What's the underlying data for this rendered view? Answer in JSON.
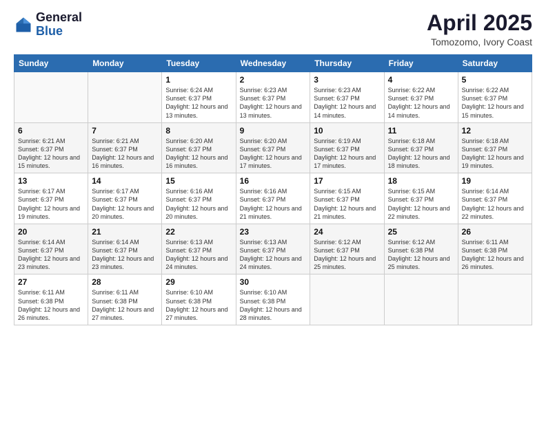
{
  "header": {
    "logo_general": "General",
    "logo_blue": "Blue",
    "month_title": "April 2025",
    "location": "Tomozomo, Ivory Coast"
  },
  "days_of_week": [
    "Sunday",
    "Monday",
    "Tuesday",
    "Wednesday",
    "Thursday",
    "Friday",
    "Saturday"
  ],
  "weeks": [
    [
      {
        "day": "",
        "sunrise": "",
        "sunset": "",
        "daylight": "",
        "empty": true
      },
      {
        "day": "",
        "sunrise": "",
        "sunset": "",
        "daylight": "",
        "empty": true
      },
      {
        "day": "1",
        "sunrise": "Sunrise: 6:24 AM",
        "sunset": "Sunset: 6:37 PM",
        "daylight": "Daylight: 12 hours and 13 minutes."
      },
      {
        "day": "2",
        "sunrise": "Sunrise: 6:23 AM",
        "sunset": "Sunset: 6:37 PM",
        "daylight": "Daylight: 12 hours and 13 minutes."
      },
      {
        "day": "3",
        "sunrise": "Sunrise: 6:23 AM",
        "sunset": "Sunset: 6:37 PM",
        "daylight": "Daylight: 12 hours and 14 minutes."
      },
      {
        "day": "4",
        "sunrise": "Sunrise: 6:22 AM",
        "sunset": "Sunset: 6:37 PM",
        "daylight": "Daylight: 12 hours and 14 minutes."
      },
      {
        "day": "5",
        "sunrise": "Sunrise: 6:22 AM",
        "sunset": "Sunset: 6:37 PM",
        "daylight": "Daylight: 12 hours and 15 minutes."
      }
    ],
    [
      {
        "day": "6",
        "sunrise": "Sunrise: 6:21 AM",
        "sunset": "Sunset: 6:37 PM",
        "daylight": "Daylight: 12 hours and 15 minutes."
      },
      {
        "day": "7",
        "sunrise": "Sunrise: 6:21 AM",
        "sunset": "Sunset: 6:37 PM",
        "daylight": "Daylight: 12 hours and 16 minutes."
      },
      {
        "day": "8",
        "sunrise": "Sunrise: 6:20 AM",
        "sunset": "Sunset: 6:37 PM",
        "daylight": "Daylight: 12 hours and 16 minutes."
      },
      {
        "day": "9",
        "sunrise": "Sunrise: 6:20 AM",
        "sunset": "Sunset: 6:37 PM",
        "daylight": "Daylight: 12 hours and 17 minutes."
      },
      {
        "day": "10",
        "sunrise": "Sunrise: 6:19 AM",
        "sunset": "Sunset: 6:37 PM",
        "daylight": "Daylight: 12 hours and 17 minutes."
      },
      {
        "day": "11",
        "sunrise": "Sunrise: 6:18 AM",
        "sunset": "Sunset: 6:37 PM",
        "daylight": "Daylight: 12 hours and 18 minutes."
      },
      {
        "day": "12",
        "sunrise": "Sunrise: 6:18 AM",
        "sunset": "Sunset: 6:37 PM",
        "daylight": "Daylight: 12 hours and 19 minutes."
      }
    ],
    [
      {
        "day": "13",
        "sunrise": "Sunrise: 6:17 AM",
        "sunset": "Sunset: 6:37 PM",
        "daylight": "Daylight: 12 hours and 19 minutes."
      },
      {
        "day": "14",
        "sunrise": "Sunrise: 6:17 AM",
        "sunset": "Sunset: 6:37 PM",
        "daylight": "Daylight: 12 hours and 20 minutes."
      },
      {
        "day": "15",
        "sunrise": "Sunrise: 6:16 AM",
        "sunset": "Sunset: 6:37 PM",
        "daylight": "Daylight: 12 hours and 20 minutes."
      },
      {
        "day": "16",
        "sunrise": "Sunrise: 6:16 AM",
        "sunset": "Sunset: 6:37 PM",
        "daylight": "Daylight: 12 hours and 21 minutes."
      },
      {
        "day": "17",
        "sunrise": "Sunrise: 6:15 AM",
        "sunset": "Sunset: 6:37 PM",
        "daylight": "Daylight: 12 hours and 21 minutes."
      },
      {
        "day": "18",
        "sunrise": "Sunrise: 6:15 AM",
        "sunset": "Sunset: 6:37 PM",
        "daylight": "Daylight: 12 hours and 22 minutes."
      },
      {
        "day": "19",
        "sunrise": "Sunrise: 6:14 AM",
        "sunset": "Sunset: 6:37 PM",
        "daylight": "Daylight: 12 hours and 22 minutes."
      }
    ],
    [
      {
        "day": "20",
        "sunrise": "Sunrise: 6:14 AM",
        "sunset": "Sunset: 6:37 PM",
        "daylight": "Daylight: 12 hours and 23 minutes."
      },
      {
        "day": "21",
        "sunrise": "Sunrise: 6:14 AM",
        "sunset": "Sunset: 6:37 PM",
        "daylight": "Daylight: 12 hours and 23 minutes."
      },
      {
        "day": "22",
        "sunrise": "Sunrise: 6:13 AM",
        "sunset": "Sunset: 6:37 PM",
        "daylight": "Daylight: 12 hours and 24 minutes."
      },
      {
        "day": "23",
        "sunrise": "Sunrise: 6:13 AM",
        "sunset": "Sunset: 6:37 PM",
        "daylight": "Daylight: 12 hours and 24 minutes."
      },
      {
        "day": "24",
        "sunrise": "Sunrise: 6:12 AM",
        "sunset": "Sunset: 6:37 PM",
        "daylight": "Daylight: 12 hours and 25 minutes."
      },
      {
        "day": "25",
        "sunrise": "Sunrise: 6:12 AM",
        "sunset": "Sunset: 6:38 PM",
        "daylight": "Daylight: 12 hours and 25 minutes."
      },
      {
        "day": "26",
        "sunrise": "Sunrise: 6:11 AM",
        "sunset": "Sunset: 6:38 PM",
        "daylight": "Daylight: 12 hours and 26 minutes."
      }
    ],
    [
      {
        "day": "27",
        "sunrise": "Sunrise: 6:11 AM",
        "sunset": "Sunset: 6:38 PM",
        "daylight": "Daylight: 12 hours and 26 minutes."
      },
      {
        "day": "28",
        "sunrise": "Sunrise: 6:11 AM",
        "sunset": "Sunset: 6:38 PM",
        "daylight": "Daylight: 12 hours and 27 minutes."
      },
      {
        "day": "29",
        "sunrise": "Sunrise: 6:10 AM",
        "sunset": "Sunset: 6:38 PM",
        "daylight": "Daylight: 12 hours and 27 minutes."
      },
      {
        "day": "30",
        "sunrise": "Sunrise: 6:10 AM",
        "sunset": "Sunset: 6:38 PM",
        "daylight": "Daylight: 12 hours and 28 minutes."
      },
      {
        "day": "",
        "sunrise": "",
        "sunset": "",
        "daylight": "",
        "empty": true
      },
      {
        "day": "",
        "sunrise": "",
        "sunset": "",
        "daylight": "",
        "empty": true
      },
      {
        "day": "",
        "sunrise": "",
        "sunset": "",
        "daylight": "",
        "empty": true
      }
    ]
  ]
}
